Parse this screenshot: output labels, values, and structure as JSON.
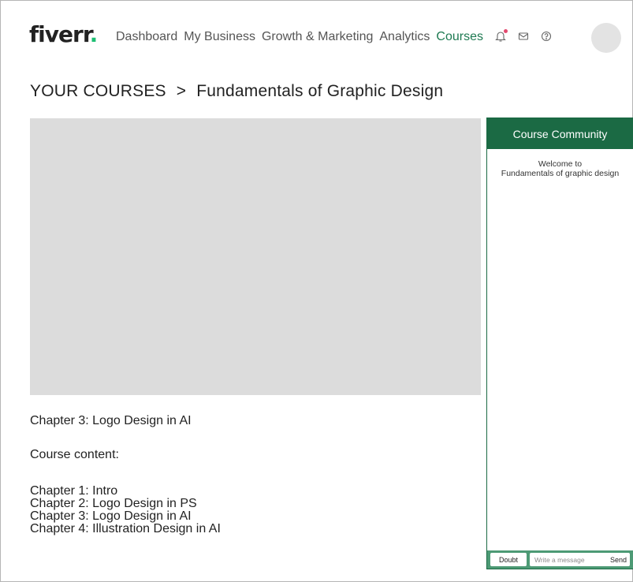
{
  "header": {
    "logo_text": "fiverr",
    "logo_dot": ".",
    "nav": [
      {
        "label": "Dashboard"
      },
      {
        "label": "My Business"
      },
      {
        "label": "Growth & Marketing"
      },
      {
        "label": "Analytics"
      },
      {
        "label": "Courses",
        "active": true
      }
    ],
    "icons": [
      "bell-icon",
      "mail-icon",
      "help-icon"
    ],
    "accent_color": "#1dbf73",
    "notification_dot_color": "#e34a6f"
  },
  "breadcrumb": {
    "root": "YOUR COURSES",
    "separator": ">",
    "current": "Fundamentals of Graphic Design"
  },
  "player": {
    "current_chapter": "Chapter 3: Logo Design in AI"
  },
  "course_content": {
    "label": "Course content:",
    "chapters": [
      "Chapter 1: Intro",
      "Chapter 2: Logo Design in PS",
      "Chapter 3: Logo Design in AI",
      "Chapter 4: Illustration Design in AI"
    ]
  },
  "community": {
    "title": "Course Community",
    "welcome_line1": "Welcome to",
    "welcome_line2": "Fundamentals of graphic design",
    "doubt_label": "Doubt",
    "message_placeholder": "Write a message",
    "send_label": "Send",
    "header_color": "#1b6a44",
    "footer_color": "#4d9a75"
  }
}
